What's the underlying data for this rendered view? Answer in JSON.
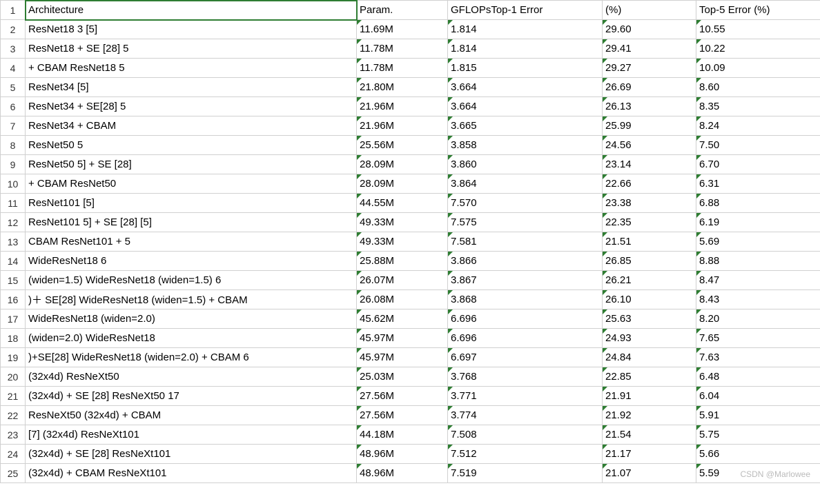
{
  "watermark": "CSDN @Marlowee",
  "columns": [
    "A",
    "B",
    "C",
    "D",
    "E"
  ],
  "header_row": {
    "A": "Architecture",
    "B": "Param.",
    "C": "GFLOPsTop-1 Error",
    "D": "(%)",
    "E": "Top-5 Error (%)"
  },
  "triangle_cols": [
    "B",
    "C",
    "D",
    "E"
  ],
  "active_cell": "A1",
  "rows": [
    {
      "n": 1,
      "A": "Architecture",
      "B": "Param.",
      "C": "GFLOPsTop-1 Error",
      "D": "(%)",
      "E": "Top-5 Error (%)"
    },
    {
      "n": 2,
      "A": "ResNet18 3 [5]",
      "B": "11.69M",
      "C": "1.814",
      "D": "29.60",
      "E": "10.55"
    },
    {
      "n": 3,
      "A": "ResNet18 + SE [28] 5",
      "B": "11.78M",
      "C": "1.814",
      "D": "29.41",
      "E": "10.22"
    },
    {
      "n": 4,
      "A": "+ CBAM ResNet18 5",
      "B": "11.78M",
      "C": "1.815",
      "D": "29.27",
      "E": "10.09"
    },
    {
      "n": 5,
      "A": "ResNet34 [5]",
      "B": "21.80M",
      "C": "3.664",
      "D": "26.69",
      "E": "8.60"
    },
    {
      "n": 6,
      "A": "ResNet34 + SE[28] 5",
      "B": "21.96M",
      "C": "3.664",
      "D": "26.13",
      "E": "8.35"
    },
    {
      "n": 7,
      "A": "ResNet34 + CBAM",
      "B": "21.96M",
      "C": "3.665",
      "D": "25.99",
      "E": "8.24"
    },
    {
      "n": 8,
      "A": "ResNet50 5",
      "B": "25.56M",
      "C": "3.858",
      "D": "24.56",
      "E": "7.50"
    },
    {
      "n": 9,
      "A": "ResNet50 5] + SE [28]",
      "B": "28.09M",
      "C": "3.860",
      "D": "23.14",
      "E": "6.70"
    },
    {
      "n": 10,
      "A": "+ CBAM ResNet50",
      "B": "28.09M",
      "C": "3.864",
      "D": "22.66",
      "E": "6.31"
    },
    {
      "n": 11,
      "A": "ResNet101 [5]",
      "B": "44.55M",
      "C": "7.570",
      "D": "23.38",
      "E": "6.88"
    },
    {
      "n": 12,
      "A": "ResNet101 5] + SE [28] [5]",
      "B": "49.33M",
      "C": "7.575",
      "D": "22.35",
      "E": "6.19"
    },
    {
      "n": 13,
      "A": "CBAM ResNet101 + 5",
      "B": "49.33M",
      "C": "7.581",
      "D": "21.51",
      "E": "5.69"
    },
    {
      "n": 14,
      "A": "WideResNet18 6",
      "B": "25.88M",
      "C": "3.866",
      "D": "26.85",
      "E": "8.88"
    },
    {
      "n": 15,
      "A": "(widen=1.5) WideResNet18 (widen=1.5) 6",
      "B": "26.07M",
      "C": "3.867",
      "D": "26.21",
      "E": "8.47"
    },
    {
      "n": 16,
      "A": ")＋ SE[28] WideResNet18 (widen=1.5) + CBAM",
      "B": "26.08M",
      "C": "3.868",
      "D": "26.10",
      "E": "8.43"
    },
    {
      "n": 17,
      "A": "WideResNet18 (widen=2.0)",
      "B": "45.62M",
      "C": "6.696",
      "D": "25.63",
      "E": "8.20"
    },
    {
      "n": 18,
      "A": "(widen=2.0) WideResNet18",
      "B": "45.97M",
      "C": "6.696",
      "D": "24.93",
      "E": "7.65"
    },
    {
      "n": 19,
      "A": ")+SE[28] WideResNet18 (widen=2.0) + CBAM 6",
      "B": "45.97M",
      "C": "6.697",
      "D": "24.84",
      "E": "7.63"
    },
    {
      "n": 20,
      "A": "(32x4d) ResNeXt50",
      "B": "25.03M",
      "C": "3.768",
      "D": "22.85",
      "E": "6.48"
    },
    {
      "n": 21,
      "A": "(32x4d) + SE [28] ResNeXt50 17",
      "B": "27.56M",
      "C": "3.771",
      "D": "21.91",
      "E": "6.04"
    },
    {
      "n": 22,
      "A": "ResNeXt50 (32x4d) + CBAM",
      "B": "27.56M",
      "C": "3.774",
      "D": "21.92",
      "E": "5.91"
    },
    {
      "n": 23,
      "A": "[7] (32x4d) ResNeXt101",
      "B": "44.18M",
      "C": "7.508",
      "D": "21.54",
      "E": "5.75"
    },
    {
      "n": 24,
      "A": "(32x4d) + SE [28] ResNeXt101",
      "B": "48.96M",
      "C": "7.512",
      "D": "21.17",
      "E": "5.66"
    },
    {
      "n": 25,
      "A": "(32x4d) + CBAM ResNeXt101",
      "B": "48.96M",
      "C": "7.519",
      "D": "21.07",
      "E": "5.59"
    }
  ],
  "chart_data": {
    "type": "table",
    "title": "Architecture comparison",
    "columns": [
      "Architecture",
      "Param.",
      "GFLOPs / Top-1 Error",
      "(%)",
      "Top-5 Error (%)"
    ],
    "rows": [
      [
        "ResNet18 3 [5]",
        "11.69M",
        "1.814",
        "29.60",
        "10.55"
      ],
      [
        "ResNet18 + SE [28] 5",
        "11.78M",
        "1.814",
        "29.41",
        "10.22"
      ],
      [
        "+ CBAM ResNet18 5",
        "11.78M",
        "1.815",
        "29.27",
        "10.09"
      ],
      [
        "ResNet34 [5]",
        "21.80M",
        "3.664",
        "26.69",
        "8.60"
      ],
      [
        "ResNet34 + SE[28] 5",
        "21.96M",
        "3.664",
        "26.13",
        "8.35"
      ],
      [
        "ResNet34 + CBAM",
        "21.96M",
        "3.665",
        "25.99",
        "8.24"
      ],
      [
        "ResNet50 5",
        "25.56M",
        "3.858",
        "24.56",
        "7.50"
      ],
      [
        "ResNet50 5] + SE [28]",
        "28.09M",
        "3.860",
        "23.14",
        "6.70"
      ],
      [
        "+ CBAM ResNet50",
        "28.09M",
        "3.864",
        "22.66",
        "6.31"
      ],
      [
        "ResNet101 [5]",
        "44.55M",
        "7.570",
        "23.38",
        "6.88"
      ],
      [
        "ResNet101 5] + SE [28] [5]",
        "49.33M",
        "7.575",
        "22.35",
        "6.19"
      ],
      [
        "CBAM ResNet101 + 5",
        "49.33M",
        "7.581",
        "21.51",
        "5.69"
      ],
      [
        "WideResNet18 6",
        "25.88M",
        "3.866",
        "26.85",
        "8.88"
      ],
      [
        "(widen=1.5) WideResNet18 (widen=1.5) 6",
        "26.07M",
        "3.867",
        "26.21",
        "8.47"
      ],
      [
        ")＋ SE[28] WideResNet18 (widen=1.5) + CBAM",
        "26.08M",
        "3.868",
        "26.10",
        "8.43"
      ],
      [
        "WideResNet18 (widen=2.0)",
        "45.62M",
        "6.696",
        "25.63",
        "8.20"
      ],
      [
        "(widen=2.0) WideResNet18",
        "45.97M",
        "6.696",
        "24.93",
        "7.65"
      ],
      [
        ")+SE[28] WideResNet18 (widen=2.0) + CBAM 6",
        "45.97M",
        "6.697",
        "24.84",
        "7.63"
      ],
      [
        "(32x4d) ResNeXt50",
        "25.03M",
        "3.768",
        "22.85",
        "6.48"
      ],
      [
        "(32x4d) + SE [28] ResNeXt50 17",
        "27.56M",
        "3.771",
        "21.91",
        "6.04"
      ],
      [
        "ResNeXt50 (32x4d) + CBAM",
        "27.56M",
        "3.774",
        "21.92",
        "5.91"
      ],
      [
        "[7] (32x4d) ResNeXt101",
        "44.18M",
        "7.508",
        "21.54",
        "5.75"
      ],
      [
        "(32x4d) + SE [28] ResNeXt101",
        "48.96M",
        "7.512",
        "21.17",
        "5.66"
      ],
      [
        "(32x4d) + CBAM ResNeXt101",
        "48.96M",
        "7.519",
        "21.07",
        "5.59"
      ]
    ]
  }
}
